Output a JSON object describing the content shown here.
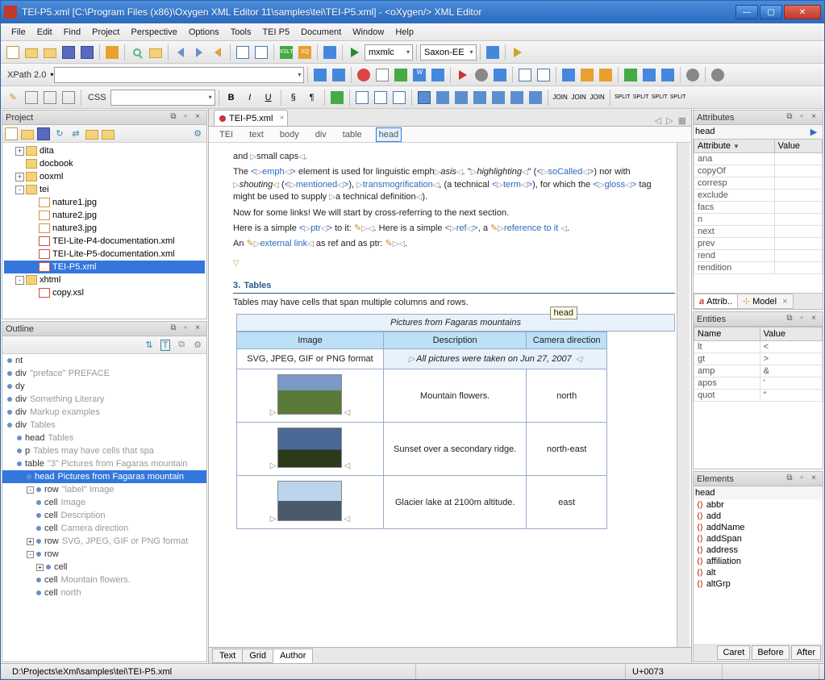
{
  "window": {
    "title": "TEI-P5.xml [C:\\Program Files (x86)\\Oxygen XML Editor 11\\samples\\tei\\TEI-P5.xml] - <oXygen/> XML Editor"
  },
  "menu": [
    "File",
    "Edit",
    "Find",
    "Project",
    "Perspective",
    "Options",
    "Tools",
    "TEI P5",
    "Document",
    "Window",
    "Help"
  ],
  "xpath": {
    "label": "XPath 2.0",
    "value": ""
  },
  "toolbar2": {
    "mxmlc": "mxmlc",
    "saxon": "Saxon-EE"
  },
  "css_label": "CSS",
  "project": {
    "title": "Project",
    "items": [
      {
        "kind": "folder",
        "name": "dita",
        "lvl": 1,
        "twist": "+"
      },
      {
        "kind": "folder",
        "name": "docbook",
        "lvl": 1,
        "twist": ""
      },
      {
        "kind": "folder",
        "name": "ooxml",
        "lvl": 1,
        "twist": "+"
      },
      {
        "kind": "folder",
        "name": "tei",
        "lvl": 1,
        "twist": "-"
      },
      {
        "kind": "file",
        "name": "nature1.jpg",
        "lvl": 2
      },
      {
        "kind": "file",
        "name": "nature2.jpg",
        "lvl": 2
      },
      {
        "kind": "file",
        "name": "nature3.jpg",
        "lvl": 2
      },
      {
        "kind": "xml",
        "name": "TEI-Lite-P4-documentation.xml",
        "lvl": 2
      },
      {
        "kind": "xml",
        "name": "TEI-Lite-P5-documentation.xml",
        "lvl": 2
      },
      {
        "kind": "xml",
        "name": "TEI-P5.xml",
        "lvl": 2,
        "selected": true
      },
      {
        "kind": "folder",
        "name": "xhtml",
        "lvl": 1,
        "twist": "-"
      },
      {
        "kind": "xml",
        "name": "copy.xsl",
        "lvl": 2
      }
    ]
  },
  "outline": {
    "title": "Outline",
    "items": [
      {
        "tag": "nt",
        "txt": "",
        "lvl": 1
      },
      {
        "tag": "div",
        "txt": "\"preface\" PREFACE",
        "lvl": 1
      },
      {
        "tag": "dy",
        "txt": "",
        "lvl": 1
      },
      {
        "tag": "div",
        "txt": "Something Literary",
        "lvl": 1
      },
      {
        "tag": "div",
        "txt": "Markup examples",
        "lvl": 1
      },
      {
        "tag": "div",
        "txt": "Tables",
        "lvl": 1
      },
      {
        "tag": "head",
        "txt": "Tables",
        "lvl": 2
      },
      {
        "tag": "p",
        "txt": "Tables may have cells that spa",
        "lvl": 2
      },
      {
        "tag": "table",
        "txt": "\"3\" Pictures from Fagaras mountain",
        "lvl": 2
      },
      {
        "tag": "head",
        "txt": "Pictures from Fagaras mountain",
        "lvl": 3,
        "selected": true
      },
      {
        "tag": "row",
        "txt": "\"label\" Image",
        "lvl": 3,
        "twist": "-"
      },
      {
        "tag": "cell",
        "txt": "Image",
        "lvl": 4
      },
      {
        "tag": "cell",
        "txt": "Description",
        "lvl": 4
      },
      {
        "tag": "cell",
        "txt": "Camera direction",
        "lvl": 4
      },
      {
        "tag": "row",
        "txt": "SVG, JPEG, GIF or PNG format",
        "lvl": 3,
        "twist": "+"
      },
      {
        "tag": "row",
        "txt": "",
        "lvl": 3,
        "twist": "-"
      },
      {
        "tag": "cell",
        "txt": "",
        "lvl": 4,
        "twist": "+"
      },
      {
        "tag": "cell",
        "txt": "Mountain flowers.",
        "lvl": 4
      },
      {
        "tag": "cell",
        "txt": "north",
        "lvl": 4
      }
    ]
  },
  "editor": {
    "tab": "TEI-P5.xml",
    "breadcrumb": [
      "TEI",
      "text",
      "body",
      "div",
      "table",
      "head"
    ],
    "p1a": "and ",
    "p1b": "small caps",
    "p2": {
      "pre": "The ",
      "emph": "emph",
      "mid": " element is used for linguistic emph",
      "asis": "asis",
      "dot": ". \"",
      "hl": "highlighting",
      "q": "\" (",
      "so": "soCalled",
      "nor": ") nor with ",
      "sh": "shouting",
      "op": " (",
      "men": "mentioned",
      "cp": "), ",
      "trans": "transmogrification",
      "cp2": ", (a technical ",
      "term": "term",
      "cp3": "), for which the ",
      "gloss": "gloss",
      "tail": " tag might be used to supply ",
      "def": "a technical definition",
      "end": ")."
    },
    "p3": "Now for some links! We will start by cross-referring to the next section.",
    "p4": {
      "a": "Here is a simple ",
      "ptr": "ptr",
      "b": " to it: ",
      "c": ". Here is a simple ",
      "ref": "ref",
      "d": ", a ",
      "reftxt": "reference to it",
      "e": "."
    },
    "p5": {
      "a": "An ",
      "link": "external link",
      "b": " as ref and as ptr: ",
      "c": "."
    },
    "section_num": "3.",
    "section_title": "Tables",
    "p6": "Tables may have cells that span multiple columns and rows.",
    "caption": "Pictures from Fagaras mountains",
    "tooltip": "head",
    "th": [
      "Image",
      "Description",
      "Camera direction"
    ],
    "format_row": {
      "fmt": "SVG, JPEG, GIF or PNG format",
      "note": "All pictures were taken on Jun 27, 2007"
    },
    "rows": [
      {
        "desc": "Mountain flowers.",
        "dir": "north"
      },
      {
        "desc": "Sunset over a secondary ridge.",
        "dir": "north-east"
      },
      {
        "desc": "Glacier lake at 2100m altitude.",
        "dir": "east"
      }
    ],
    "modes": [
      "Text",
      "Grid",
      "Author"
    ]
  },
  "attributes": {
    "title": "Attributes",
    "selected": "head",
    "cols": [
      "Attribute",
      "Value"
    ],
    "rows": [
      "ana",
      "copyOf",
      "corresp",
      "exclude",
      "facs",
      "n",
      "next",
      "prev",
      "rend",
      "rendition"
    ],
    "tabs": [
      "Attrib..",
      "Model"
    ]
  },
  "entities": {
    "title": "Entities",
    "cols": [
      "Name",
      "Value"
    ],
    "rows": [
      [
        "lt",
        "<"
      ],
      [
        "gt",
        ">"
      ],
      [
        "amp",
        "&"
      ],
      [
        "apos",
        "'"
      ],
      [
        "quot",
        "\""
      ]
    ]
  },
  "elements": {
    "title": "Elements",
    "selected": "head",
    "items": [
      "abbr",
      "add",
      "addName",
      "addSpan",
      "address",
      "affiliation",
      "alt",
      "altGrp"
    ],
    "buttons": [
      "Caret",
      "Before",
      "After"
    ]
  },
  "status": {
    "path": "D:\\Projects\\eXml\\samples\\tei\\TEI-P5.xml",
    "unicode": "U+0073"
  }
}
